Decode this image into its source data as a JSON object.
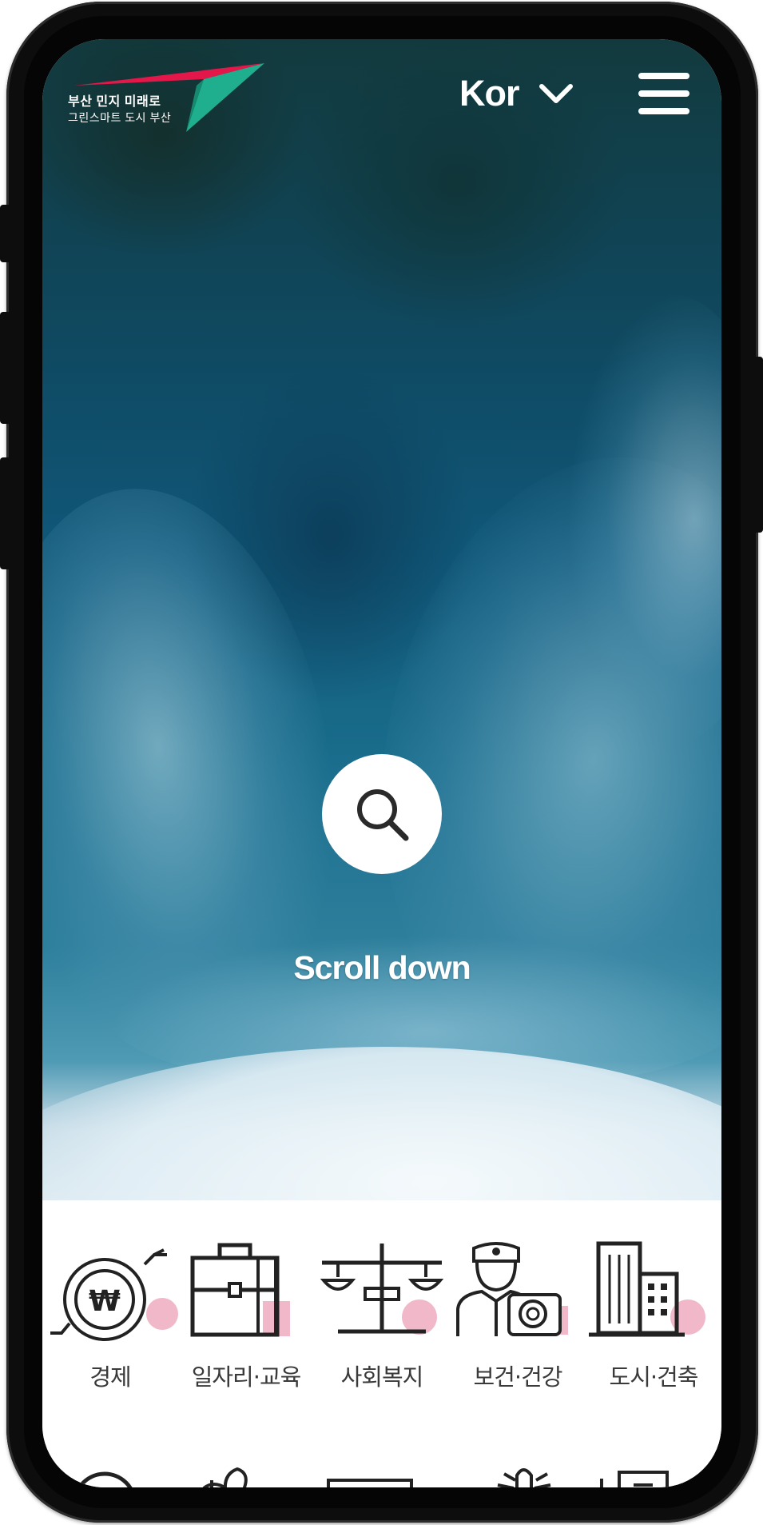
{
  "header": {
    "logo_text_line1": "부산 민지 미래로",
    "logo_text_line2": "그린스마트 도시 부산",
    "language_label": "Kor"
  },
  "hero": {
    "scroll_label": "Scroll down"
  },
  "categories": [
    {
      "label": "경제",
      "icon": "economy-won-icon"
    },
    {
      "label": "일자리·교육",
      "icon": "briefcase-icon"
    },
    {
      "label": "사회복지",
      "icon": "scales-icon"
    },
    {
      "label": "보건·건강",
      "icon": "health-officer-icon"
    },
    {
      "label": "도시·건축",
      "icon": "buildings-icon"
    }
  ],
  "colors": {
    "logo_red": "#e4174a",
    "logo_green": "#1fae8e",
    "icon_accent_pink": "#f0b8c8",
    "icon_stroke": "#222222",
    "label_text": "#3a3a3a"
  }
}
